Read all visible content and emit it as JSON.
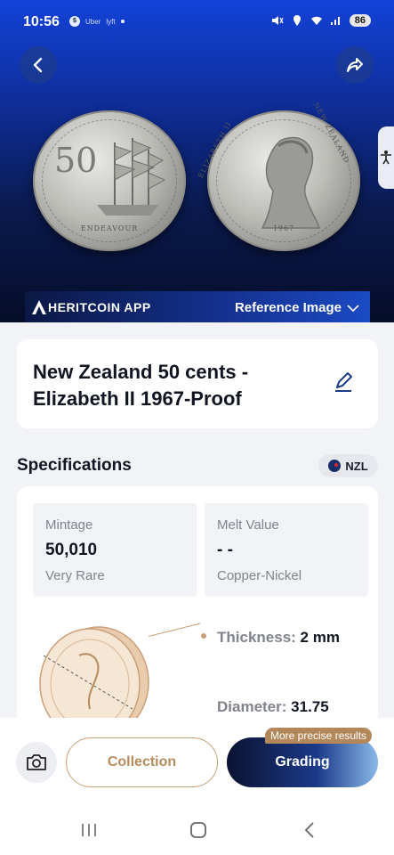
{
  "status_bar": {
    "time": "10:56",
    "battery": "86",
    "left_icons": [
      "currency-icon",
      "uber-icon",
      "lyft-icon",
      "dot"
    ],
    "uber_text": "Uber",
    "lyft_text": "lyft",
    "right_icons": [
      "mute-icon",
      "location-icon",
      "wifi-icon",
      "signal-icon",
      "battery-icon"
    ]
  },
  "hero": {
    "coin_front": {
      "denomination": "50",
      "legend": "ENDEAVOUR"
    },
    "coin_back": {
      "legend_left": "ELIZABETH II",
      "legend_right": "NEW ZEALAND",
      "year": "1967"
    },
    "brand": "HERITCOIN APP",
    "reference_label": "Reference Image"
  },
  "coin": {
    "title": "New Zealand 50 cents - Elizabeth II 1967-Proof"
  },
  "specs": {
    "heading": "Specifications",
    "country": "NZL",
    "mintage": {
      "label": "Mintage",
      "value": "50,010",
      "sub": "Very Rare"
    },
    "melt": {
      "label": "Melt Value",
      "value": "- -",
      "sub": "Copper-Nickel"
    },
    "thickness": {
      "label": "Thickness:",
      "value": "2 mm"
    },
    "diameter": {
      "label": "Diameter:",
      "value": "31.75"
    }
  },
  "actions": {
    "collection": "Collection",
    "grading": "Grading",
    "badge": "More precise results"
  },
  "colors": {
    "accent_gold": "#c9a07a",
    "hero_blue": "#1242d8",
    "dark_navy": "#0a1230"
  }
}
